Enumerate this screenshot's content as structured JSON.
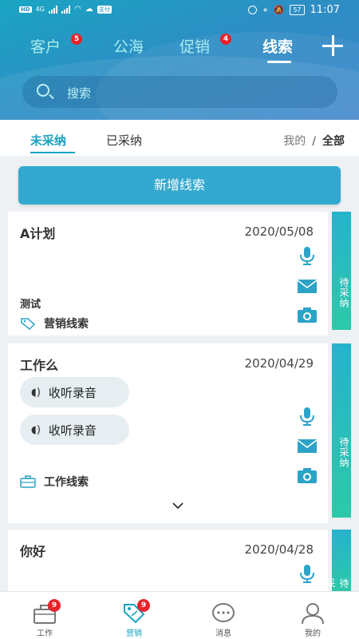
{
  "status_bar": {
    "time": "11:07",
    "battery": "57",
    "left_badge": "HD",
    "network": "4G",
    "pay": "支付"
  },
  "nav": {
    "tabs": [
      {
        "label": "客户",
        "badge": "5"
      },
      {
        "label": "公海",
        "badge": ""
      },
      {
        "label": "促销",
        "badge": "4"
      },
      {
        "label": "线索",
        "badge": ""
      }
    ]
  },
  "search": {
    "placeholder": "搜索"
  },
  "subtabs": {
    "unadopted": "未采纳",
    "adopted": "已采纳",
    "mine": "我的",
    "separator": "/",
    "all": "全部"
  },
  "add_button": "新增线索",
  "cards": [
    {
      "title": "A计划",
      "date": "2020/05/08",
      "note": "测试",
      "type": "营销线索",
      "status": "待采纳"
    },
    {
      "title": "工作么",
      "date": "2020/04/29",
      "audio_label": "收听录音",
      "type": "工作线索",
      "status": "待采纳"
    },
    {
      "title": "你好",
      "date": "2020/04/28",
      "status": "待采"
    }
  ],
  "tabbar": [
    {
      "label": "工作",
      "badge": "9"
    },
    {
      "label": "营销",
      "badge": "9"
    },
    {
      "label": "消息",
      "badge": ""
    },
    {
      "label": "我的",
      "badge": ""
    }
  ],
  "colors": {
    "accent": "#1aa1c0",
    "badge": "#e8232b",
    "button": "#34a9cf",
    "icon": "#2ca3c7"
  }
}
